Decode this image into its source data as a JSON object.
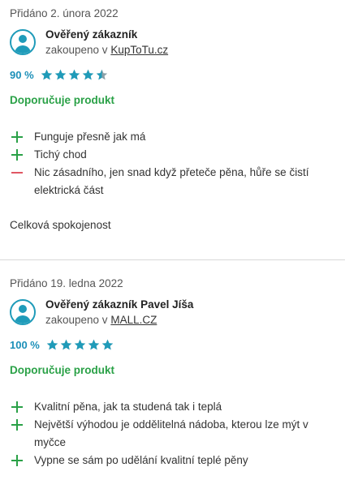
{
  "reviews": [
    {
      "date": "Přidáno 2. února 2022",
      "author": "Ověřený zákazník",
      "bought_prefix": "zakoupeno v",
      "shop": "KupToTu.cz",
      "percent": "90 %",
      "stars": 4.5,
      "recommend": "Doporučuje produkt",
      "pros": [
        "Funguje přesně jak má",
        "Tichý chod"
      ],
      "cons": [
        "Nic zásadního, jen snad když přeteče pěna, hůře se čistí elektrická část"
      ],
      "overall": "Celková spokojenost"
    },
    {
      "date": "Přidáno 19. ledna 2022",
      "author": "Ověřený zákazník Pavel Jíša",
      "bought_prefix": "zakoupeno v",
      "shop": "MALL.CZ",
      "percent": "100 %",
      "stars": 5,
      "recommend": "Doporučuje produkt",
      "pros": [
        "Kvalitní pěna, jak ta studená tak i teplá",
        "Největší výhodou je oddělitelná nádoba, kterou lze mýt v myčce",
        "Vypne se sám po udělání kvalitní teplé pěny"
      ],
      "cons": []
    }
  ],
  "colors": {
    "star": "#1f9bb9",
    "star_empty": "#8aa0a8",
    "plus": "#2aa147",
    "minus": "#e05763",
    "recommend": "#2aa147",
    "percent": "#1b8fb8"
  }
}
